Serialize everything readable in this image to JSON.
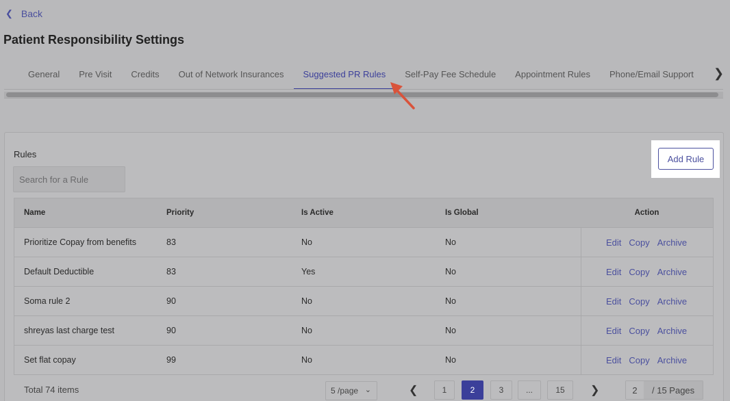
{
  "nav": {
    "back_label": "Back"
  },
  "page_title": "Patient Responsibility Settings",
  "tabs": [
    {
      "label": "General"
    },
    {
      "label": "Pre Visit"
    },
    {
      "label": "Credits"
    },
    {
      "label": "Out of Network Insurances"
    },
    {
      "label": "Suggested PR Rules"
    },
    {
      "label": "Self-Pay Fee Schedule"
    },
    {
      "label": "Appointment Rules"
    },
    {
      "label": "Phone/Email Support"
    }
  ],
  "active_tab": "Suggested PR Rules",
  "rules": {
    "label": "Rules",
    "search_placeholder": "Search for a Rule",
    "add_rule_label": "Add Rule"
  },
  "table": {
    "headers": [
      "Name",
      "Priority",
      "Is Active",
      "Is Global",
      "Action"
    ],
    "rows": [
      [
        "Prioritize Copay from benefits",
        "83",
        "No",
        "No"
      ],
      [
        "Default Deductible",
        "83",
        "Yes",
        "No"
      ],
      [
        "Soma rule 2",
        "90",
        "No",
        "No"
      ],
      [
        "shreyas last charge test",
        "90",
        "No",
        "No"
      ],
      [
        "Set flat copay",
        "99",
        "No",
        "No"
      ]
    ],
    "actions": [
      "Edit",
      "Copy",
      "Archive"
    ]
  },
  "pagination": {
    "total": "Total 74 items",
    "page_size": "5 /page",
    "pages": [
      "1",
      "2",
      "3",
      "...",
      "15"
    ],
    "current_page": "2",
    "jump_value": "2",
    "jump_suffix": "/ 15 Pages"
  },
  "colors": {
    "accent": "#3b3f9a",
    "link": "#4a4f9e",
    "annotation_arrow": "#d9533b",
    "overlay_bg": "#b9b9bb"
  },
  "icons": {
    "back": "chevron-left-icon",
    "tab_scroll": "chevron-right-icon",
    "page_size_dropdown": "chevron-down-icon"
  }
}
